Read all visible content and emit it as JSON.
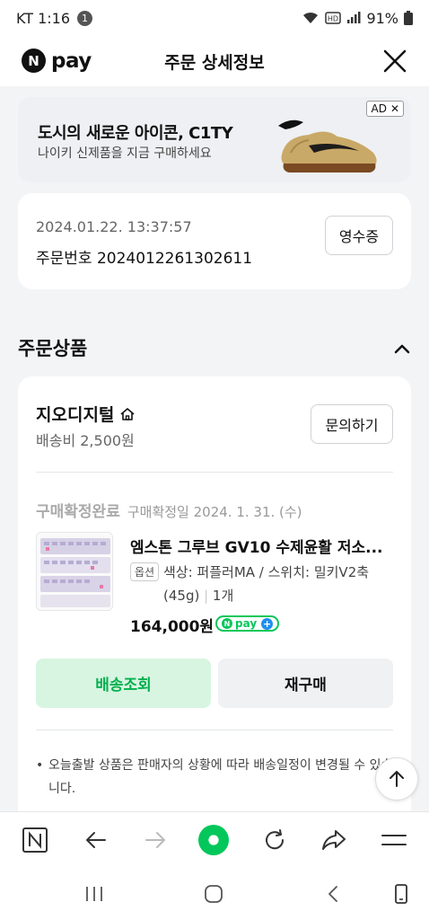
{
  "status_bar": {
    "carrier_time": "KT 1:16",
    "notification_count": "1",
    "battery": "91%"
  },
  "header": {
    "logo_letter": "N",
    "logo_text": "pay",
    "title": "주문 상세정보"
  },
  "ad": {
    "title": "도시의 새로운 아이콘, C1TY",
    "subtitle": "나이키 신제품을 지금 구매하세요",
    "badge": "AD",
    "badge_close": "✕"
  },
  "order": {
    "datetime": "2024.01.22. 13:37:57",
    "order_number": "주문번호 2024012261302611",
    "receipt_label": "영수증"
  },
  "section": {
    "title": "주문상품"
  },
  "seller": {
    "name": "지오디지털",
    "shipping_fee": "배송비 2,500원",
    "inquiry_label": "문의하기"
  },
  "item": {
    "status": "구매확정완료",
    "status_date": "구매확정일 2024. 1. 31. (수)",
    "name": "엠스톤 그루브 GV10 수제윤활 저소...",
    "option_tag": "옵션",
    "option_text": "색상: 퍼플러MA / 스위치: 밀키V2축(45g)",
    "quantity": "1개",
    "price": "164,000원",
    "npay_badge_text": "pay"
  },
  "actions": {
    "track_label": "배송조회",
    "rebuy_label": "재구매"
  },
  "notice": {
    "text": "오늘출발 상품은 판매자의 상황에 따라 배송일정이 변경될 수 있습니다."
  },
  "colors": {
    "accent_green": "#03c75a",
    "track_button_bg": "#d8f5e1"
  }
}
